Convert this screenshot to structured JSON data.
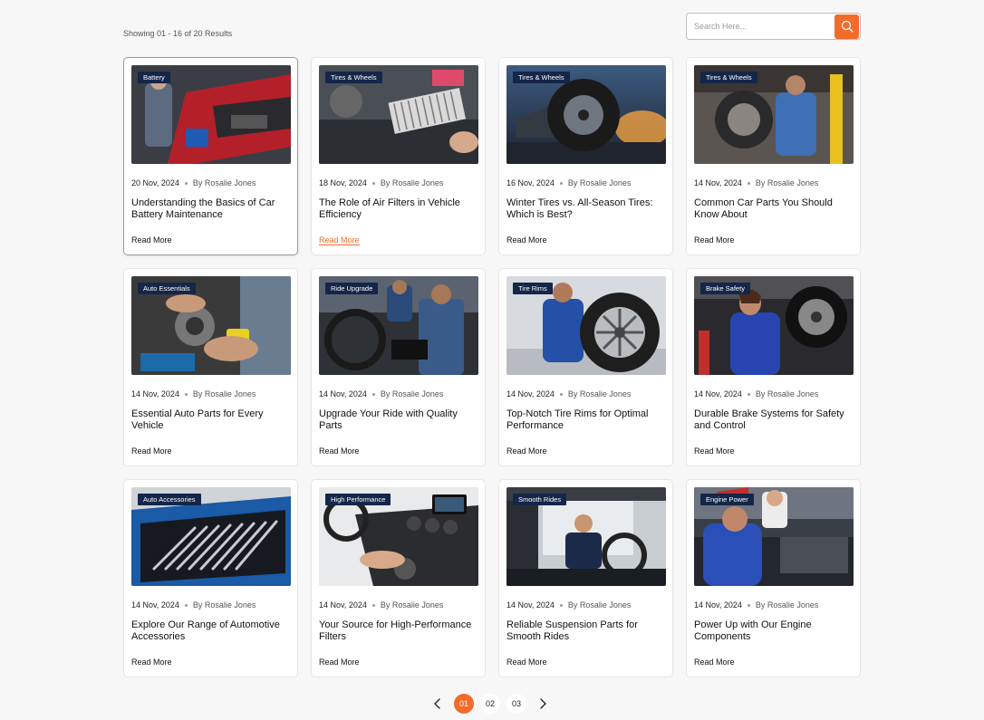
{
  "results_label": "Showing 01 - 16 of 20 Results",
  "search": {
    "placeholder": "Search Here...",
    "button_icon": "search-icon"
  },
  "read_more_label": "Read More",
  "colors": {
    "accent": "#f26b2a",
    "badge": "#142649"
  },
  "posts": [
    {
      "category": "Battery",
      "date": "20 Nov, 2024",
      "author": "By Rosalie Jones",
      "title": "Understanding the Basics of Car Battery Maintenance"
    },
    {
      "category": "Tires & Wheels",
      "date": "18 Nov, 2024",
      "author": "By Rosalie Jones",
      "title": "The Role of Air Filters in Vehicle Efficiency"
    },
    {
      "category": "Tires & Wheels",
      "date": "16 Nov, 2024",
      "author": "By Rosalie Jones",
      "title": "Winter Tires vs. All-Season Tires: Which is Best?"
    },
    {
      "category": "Tires & Wheels",
      "date": "14 Nov, 2024",
      "author": "By Rosalie Jones",
      "title": "Common Car Parts You Should Know About"
    },
    {
      "category": "Auto Essentials",
      "date": "14 Nov, 2024",
      "author": "By Rosalie Jones",
      "title": "Essential Auto Parts for Every Vehicle"
    },
    {
      "category": "Ride Upgrade",
      "date": "14 Nov, 2024",
      "author": "By Rosalie Jones",
      "title": "Upgrade Your Ride with Quality Parts"
    },
    {
      "category": "Tire Rims",
      "date": "14 Nov, 2024",
      "author": "By Rosalie Jones",
      "title": "Top-Notch Tire Rims for Optimal Performance"
    },
    {
      "category": "Brake Safety",
      "date": "14 Nov, 2024",
      "author": "By Rosalie Jones",
      "title": "Durable Brake Systems for Safety and Control"
    },
    {
      "category": "Auto Accessories",
      "date": "14 Nov, 2024",
      "author": "By Rosalie Jones",
      "title": "Explore Our Range of Automotive Accessories"
    },
    {
      "category": "High Performance",
      "date": "14 Nov, 2024",
      "author": "By Rosalie Jones",
      "title": "Your Source for High-Performance Filters"
    },
    {
      "category": "Smooth Rides",
      "date": "14 Nov, 2024",
      "author": "By Rosalie Jones",
      "title": "Reliable Suspension Parts for Smooth Rides"
    },
    {
      "category": "Engine Power",
      "date": "14 Nov, 2024",
      "author": "By Rosalie Jones",
      "title": "Power Up with Our Engine Components"
    }
  ],
  "pagination": {
    "pages": [
      "01",
      "02",
      "03"
    ],
    "current": "01"
  }
}
